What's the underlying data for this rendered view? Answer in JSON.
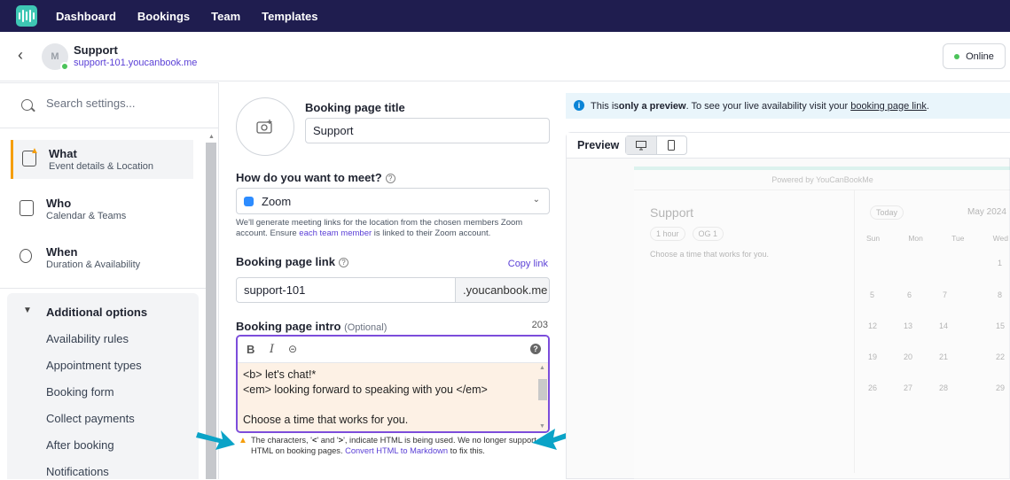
{
  "nav": {
    "items": [
      "Dashboard",
      "Bookings",
      "Team",
      "Templates"
    ]
  },
  "header": {
    "avatar_initials": "M",
    "name": "Support",
    "url": "support-101.youcanbook.me",
    "status": "Online"
  },
  "sidebar": {
    "search_placeholder": "Search settings...",
    "items": [
      {
        "title": "What",
        "subtitle": "Event details & Location",
        "active": true,
        "warning": true
      },
      {
        "title": "Who",
        "subtitle": "Calendar & Teams"
      },
      {
        "title": "When",
        "subtitle": "Duration & Availability"
      }
    ],
    "additional": {
      "title": "Additional options",
      "items": [
        "Availability rules",
        "Appointment types",
        "Booking form",
        "Collect payments",
        "After booking",
        "Notifications"
      ]
    }
  },
  "form": {
    "title_label": "Booking page title",
    "title_value": "Support",
    "meet_label": "How do you want to meet?",
    "meet_value": "Zoom",
    "meet_help_1": "We'll generate meeting links for the location from the chosen members Zoom account. Ensure ",
    "meet_help_link": "each team member",
    "meet_help_2": " is linked to their Zoom account.",
    "link_label": "Booking page link",
    "copy_link": "Copy link",
    "link_value": "support-101",
    "link_suffix": ".youcanbook.me",
    "intro_label": "Booking page intro",
    "intro_optional": "(Optional)",
    "intro_count": "203",
    "intro_lines": [
      "<b> let's chat!*",
      "<em> looking forward to speaking with you </em>",
      "",
      "Choose a time that works for you."
    ],
    "warning_1": "The characters, '",
    "warning_lt": "<",
    "warning_2": "' and '",
    "warning_gt": ">",
    "warning_3": "', indicate HTML is being used. We no longer support HTML on booking pages. ",
    "warning_link": "Convert HTML to Markdown",
    "warning_4": " to fix this."
  },
  "preview": {
    "info_1": "This is ",
    "info_bold": "only a preview",
    "info_2": ". To see your live availability visit your ",
    "info_link": "booking page link",
    "info_3": ".",
    "title": "Preview",
    "powered": "Powered by YouCanBookMe",
    "page_title": "Support",
    "duration": "1 hour",
    "host": "OG 1",
    "choose": "Choose a time that works for you.",
    "today": "Today",
    "month": "May 2024",
    "weekdays": [
      "Sun",
      "Mon",
      "Tue",
      "Wed"
    ],
    "dates": [
      "5",
      "6",
      "7",
      "8",
      "12",
      "13",
      "14",
      "15",
      "19",
      "20",
      "21",
      "22",
      "26",
      "27",
      "28",
      "29",
      "1"
    ]
  },
  "colors": {
    "accent": "#5a3fd6",
    "topbar": "#1f1d4f",
    "warning": "#f59e0b",
    "arrow": "#0aa3c7"
  }
}
